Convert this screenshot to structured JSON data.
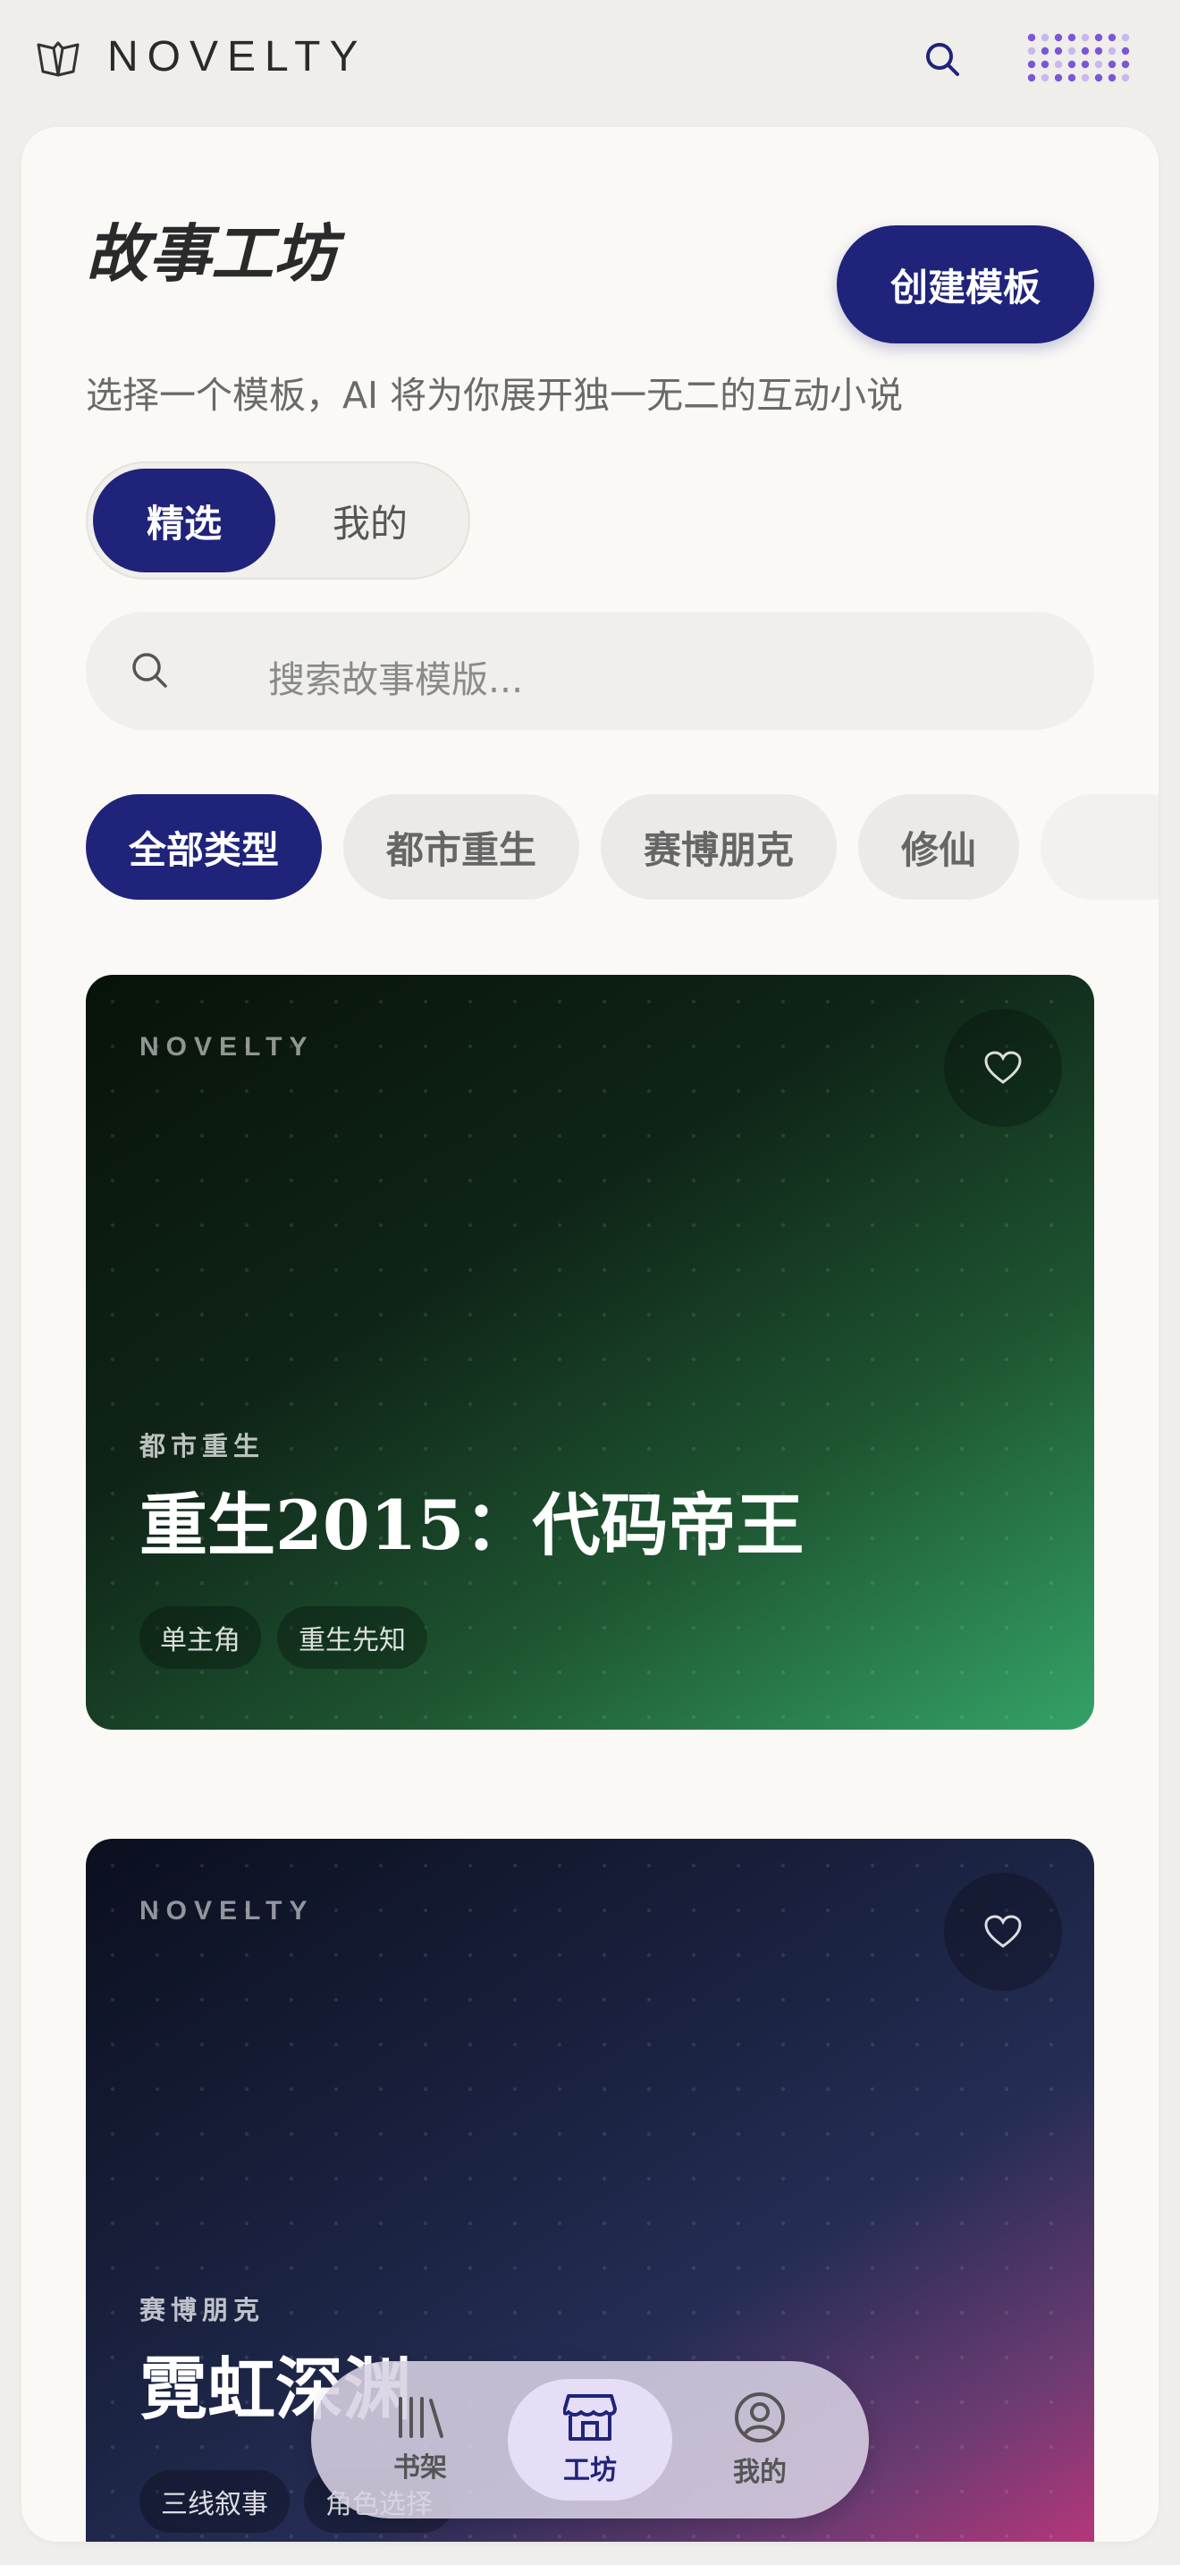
{
  "app": {
    "brand": "NOVELTY"
  },
  "header": {
    "title": "故事工坊",
    "create_label": "创建模板",
    "subtitle": "选择一个模板，AI 将为你展开独一无二的互动小说"
  },
  "tabs": [
    {
      "label": "精选",
      "active": true
    },
    {
      "label": "我的",
      "active": false
    }
  ],
  "search": {
    "placeholder": "搜索故事模版..."
  },
  "genres": [
    {
      "label": "全部类型",
      "active": true
    },
    {
      "label": "都市重生",
      "active": false
    },
    {
      "label": "赛博朋克",
      "active": false
    },
    {
      "label": "修仙",
      "active": false
    }
  ],
  "cards": [
    {
      "brand": "NOVELTY",
      "genre": "都市重生",
      "title": "重生2015：代码帝王",
      "tags": [
        "单主角",
        "重生先知"
      ]
    },
    {
      "brand": "NOVELTY",
      "genre": "赛博朋克",
      "title": "霓虹深渊",
      "tags": [
        "三线叙事",
        "角色选择"
      ]
    }
  ],
  "nav": [
    {
      "label": "书架",
      "icon": "bookshelf-icon",
      "active": false
    },
    {
      "label": "工坊",
      "icon": "store-icon",
      "active": true
    },
    {
      "label": "我的",
      "icon": "user-icon",
      "active": false
    }
  ],
  "colors": {
    "accent": "#1f237a",
    "background": "#efeeea",
    "panel": "#faf9f6"
  }
}
